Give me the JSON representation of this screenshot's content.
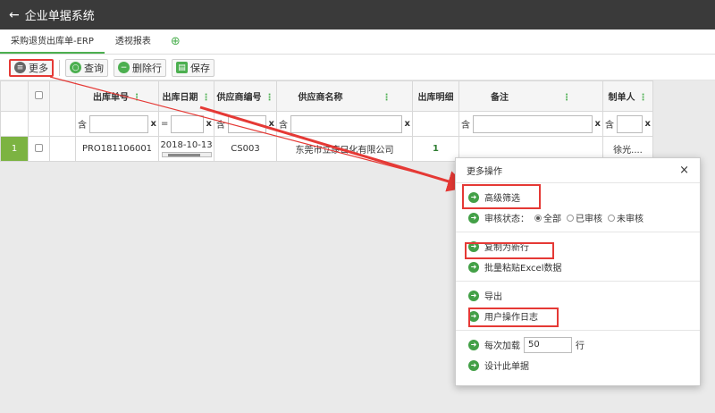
{
  "app": {
    "title": "企业单据系统",
    "back_icon": "arrow-left-icon"
  },
  "tabs": [
    {
      "label": "采购退货出库单-ERP",
      "active": true
    },
    {
      "label": "透视报表",
      "active": false
    }
  ],
  "toolbar": {
    "more_label": "更多",
    "query_label": "查询",
    "delete_row_label": "删除行",
    "save_label": "保存"
  },
  "grid": {
    "columns": [
      "出库单号",
      "出库日期",
      "供应商编号",
      "供应商名称",
      "出库明细",
      "备注",
      "制单人"
    ],
    "filter_ops": [
      "含",
      "=",
      "含",
      "含",
      "含",
      "含"
    ],
    "filter_clear": "x",
    "rows": [
      {
        "num": "1",
        "order_no": "PRO181106001",
        "date": "2018-10-13",
        "supplier_code": "CS003",
        "supplier_name": "东莞市立康日化有限公司",
        "detail": "1",
        "note": "",
        "creator": "徐光...."
      }
    ]
  },
  "dialog": {
    "title": "更多操作",
    "close": "×",
    "advanced_filter": "高级筛选",
    "audit_status_label": "审核状态：",
    "audit_options": [
      "全部",
      "已审核",
      "未审核"
    ],
    "audit_selected": "全部",
    "copy_new_row": "复制为新行",
    "batch_paste": "批量粘贴Excel数据",
    "export": "导出",
    "user_log": "用户操作日志",
    "load_prefix": "每次加载",
    "load_value": "50",
    "load_suffix": "行",
    "design": "设计此单据"
  },
  "colors": {
    "accent": "#4caf50",
    "highlight": "#e53935",
    "titlebar": "#3a3a3a"
  }
}
